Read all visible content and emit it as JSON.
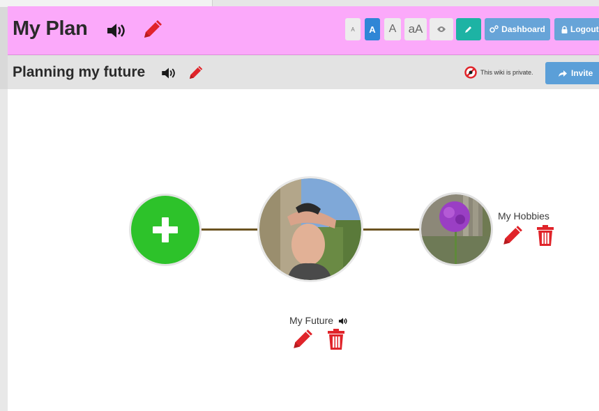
{
  "header": {
    "title": "My Plan",
    "font_sizes": [
      "A",
      "A",
      "A",
      "aA"
    ],
    "dashboard_label": "Dashboard",
    "logout_label": "Logout",
    "colors": {
      "background": "#fba9fa",
      "accent": "#67a4d8",
      "edit": "#1db3a4",
      "selected_font": "#2f86d6"
    }
  },
  "subheader": {
    "title": "Planning my future",
    "privacy_text": "This wiki is private.",
    "invite_label": "Invite"
  },
  "nodes": {
    "add": {
      "icon": "plus-icon",
      "color": "#2dc22a"
    },
    "center": {
      "label": "My Future",
      "has_audio": true
    },
    "hobbies": {
      "label": "My Hobbies"
    }
  },
  "icons": {
    "speaker": "speaker-icon",
    "pencil": "pencil-icon",
    "trash": "trash-icon",
    "eye": "eye-icon",
    "gears": "gears-icon",
    "lock": "lock-icon",
    "share": "share-icon",
    "no-access": "no-access-icon"
  },
  "colors": {
    "danger": "#e0242a",
    "connector": "#6b5320"
  }
}
